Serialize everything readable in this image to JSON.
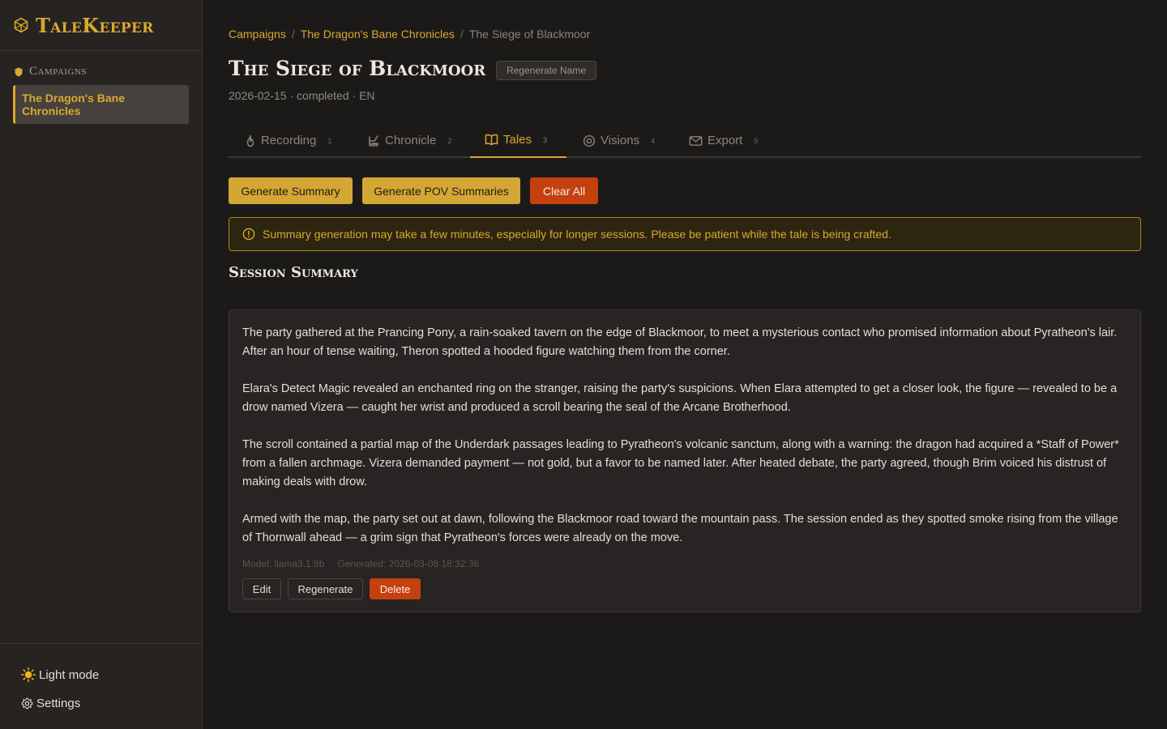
{
  "app": {
    "brand": "TaleKeeper"
  },
  "sidebar": {
    "section_label": "Campaigns",
    "items": [
      {
        "label": "The Dragon's Bane Chronicles",
        "active": true
      }
    ],
    "light_mode": "Light mode",
    "settings": "Settings"
  },
  "breadcrumb": {
    "items": [
      "Campaigns",
      "The Dragon's Bane Chronicles"
    ],
    "current": "The Siege of Blackmoor",
    "separator": "/"
  },
  "page": {
    "title": "The Siege of Blackmoor",
    "regenerate_name": "Regenerate Name",
    "meta": "2026-02-15 · completed · EN"
  },
  "tabs": [
    {
      "label": "Recording",
      "badge": "1",
      "icon": "flame-icon"
    },
    {
      "label": "Chronicle",
      "badge": "2",
      "icon": "quill-icon"
    },
    {
      "label": "Tales",
      "badge": "3",
      "icon": "book-icon",
      "active": true
    },
    {
      "label": "Visions",
      "badge": "4",
      "icon": "eye-target-icon"
    },
    {
      "label": "Export",
      "badge": "5",
      "icon": "mail-icon"
    }
  ],
  "actions": {
    "generate_summary": "Generate Summary",
    "generate_pov": "Generate POV Summaries",
    "clear_all": "Clear All"
  },
  "notice": "Summary generation may take a few minutes, especially for longer sessions. Please be patient while the tale is being crafted.",
  "summary": {
    "section_title": "Session Summary",
    "paragraphs": [
      "The party gathered at the Prancing Pony, a rain-soaked tavern on the edge of Blackmoor, to meet a mysterious contact who promised information about Pyratheon's lair. After an hour of tense waiting, Theron spotted a hooded figure watching them from the corner.",
      "Elara's Detect Magic revealed an enchanted ring on the stranger, raising the party's suspicions. When Elara attempted to get a closer look, the figure — revealed to be a drow named Vizera — caught her wrist and produced a scroll bearing the seal of the Arcane Brotherhood.",
      "The scroll contained a partial map of the Underdark passages leading to Pyratheon's volcanic sanctum, along with a warning: the dragon had acquired a *Staff of Power* from a fallen archmage. Vizera demanded payment — not gold, but a favor to be named later. After heated debate, the party agreed, though Brim voiced his distrust of making deals with drow.",
      "Armed with the map, the party set out at dawn, following the Blackmoor road toward the mountain pass. The session ended as they spotted smoke rising from the village of Thornwall ahead — a grim sign that Pyratheon's forces were already on the move."
    ],
    "model": "Model: llama3.1:8b",
    "generated": "Generated: 2026-03-08 18:32:36",
    "edit": "Edit",
    "regenerate": "Regenerate",
    "delete": "Delete"
  },
  "colors": {
    "accent": "#d9a832",
    "danger": "#c4400f",
    "background": "#1c1a19",
    "sidebar": "#262321"
  }
}
